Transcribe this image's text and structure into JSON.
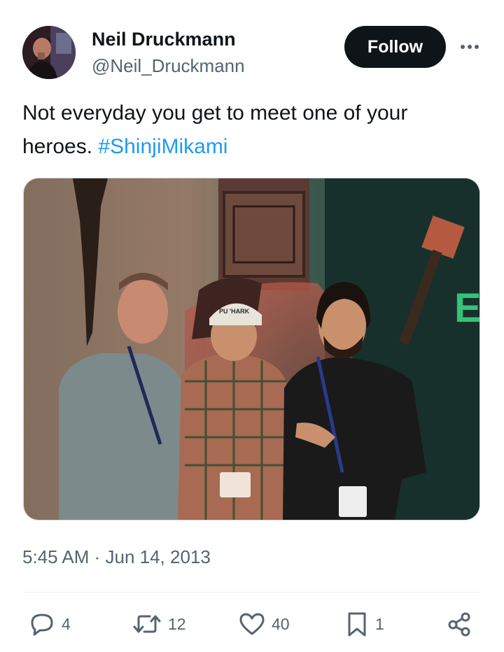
{
  "author": {
    "display_name": "Neil Druckmann",
    "handle": "@Neil_Druckmann",
    "avatar_icon": "profile-photo"
  },
  "follow_label": "Follow",
  "more_icon": "more-dots-icon",
  "tweet": {
    "text": "Not everyday you get to meet one of your heroes.",
    "hashtag": "#ShinjiMikami"
  },
  "media": {
    "description_icon": "photo",
    "sign_text": "EV W",
    "cap_text": "PU 'HARK"
  },
  "timestamp": "5:45 AM · Jun 14, 2013",
  "actions": {
    "reply_count": "4",
    "retweet_count": "12",
    "like_count": "40",
    "bookmark_count": "1"
  },
  "colors": {
    "text": "#0f1419",
    "secondary": "#536471",
    "link": "#1d9bf0",
    "button_bg": "#0f1419"
  }
}
